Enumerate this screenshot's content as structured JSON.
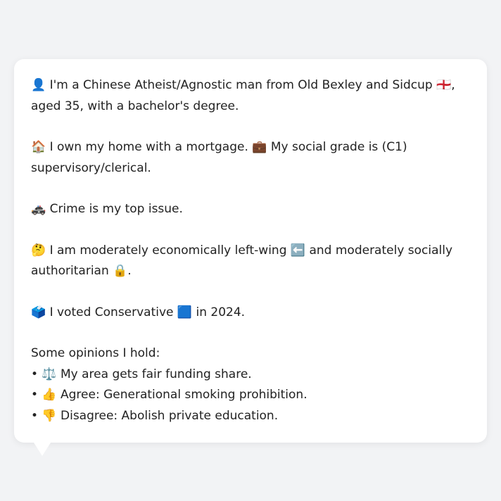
{
  "profile": {
    "identity": "👤 I'm a Chinese Atheist/Agnostic man from Old Bexley and Sidcup 🏴󠁧󠁢󠁥󠁮󠁧󠁿, aged 35, with a bachelor's degree.",
    "housing": "🏠 I own my home with a mortgage. 💼 My social grade is (C1) supervisory/clerical.",
    "top_issue": "🚓 Crime is my top issue.",
    "ideology": "🤔 I am moderately economically left-wing ⬅️ and moderately socially authoritarian 🔒.",
    "vote": "🗳️ I voted Conservative 🟦 in 2024.",
    "opinions_heading": "Some opinions I hold:",
    "opinions": [
      "• ⚖️ My area gets fair funding share.",
      "• 👍 Agree: Generational smoking prohibition.",
      "• 👎 Disagree: Abolish private education."
    ]
  }
}
